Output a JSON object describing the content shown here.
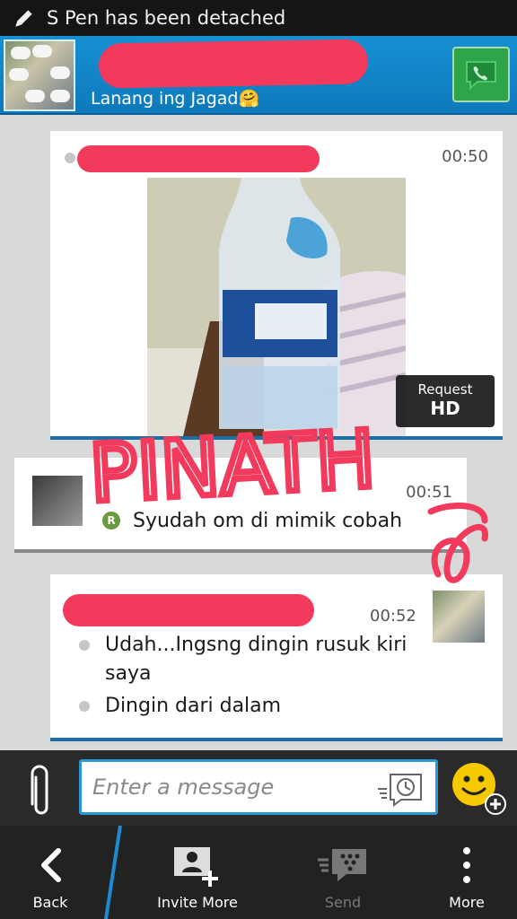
{
  "status_bar": {
    "text": "S Pen has been detached",
    "icon": "pen-icon"
  },
  "header": {
    "status_message": "Lanang ing Jagad",
    "call_icon": "phone-icon",
    "colors": {
      "header": "#1690d3",
      "redaction": "#f23a5c"
    }
  },
  "messages": [
    {
      "time": "00:50",
      "type": "picture",
      "picture_subject": "water-bottle-photo",
      "request_hd": {
        "line1": "Request",
        "line2": "HD"
      }
    },
    {
      "time": "00:51",
      "read_mark": "R",
      "text": "Syudah om di mimik cobah"
    },
    {
      "time": "00:52",
      "lines": [
        "Udah...Ingsng dingin rusuk kiri",
        "saya",
        "Dingin dari dalam"
      ]
    }
  ],
  "input": {
    "placeholder": "Enter a message"
  },
  "action_bar": {
    "back": "Back",
    "invite": "Invite More",
    "send": "Send",
    "more": "More"
  },
  "graffiti": {
    "text": "PINATH",
    "color": "#f23a5c"
  }
}
